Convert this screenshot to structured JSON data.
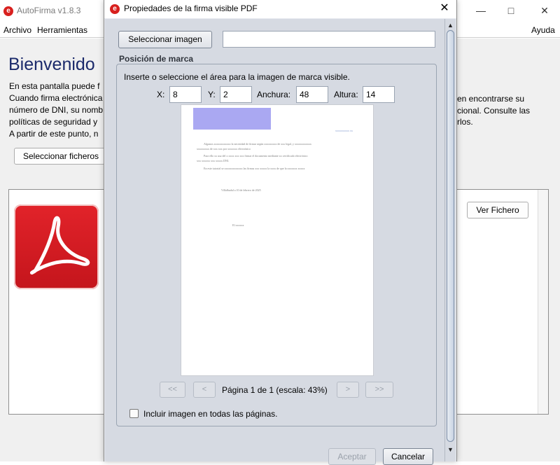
{
  "app": {
    "title": "AutoFirma v1.8.3",
    "menu": [
      "Archivo",
      "Herramientas",
      "Ayuda"
    ],
    "window_controls": [
      "minimize-icon",
      "maximize-icon",
      "close-icon"
    ]
  },
  "background": {
    "welcome_title": "Bienvenido",
    "lines_left": [
      "En esta pantalla puede f",
      "Cuando firma electrónica",
      "número de DNI, su nomb",
      "políticas de seguridad y",
      "A partir de este punto, n"
    ],
    "lines_right": [
      "en encontrarse su",
      "cional. Consulte las",
      "rlos."
    ],
    "select_files_button": "Seleccionar ficheros",
    "view_file_button": "Ver Fichero"
  },
  "dialog": {
    "title": "Propiedades de la firma visible PDF",
    "select_image_button": "Seleccionar imagen",
    "image_path_value": "",
    "position_legend": "Posición de marca",
    "instructions": "Inserte o seleccione el área para la imagen de marca visible.",
    "fields": {
      "x_label": "X:",
      "x_value": "8",
      "y_label": "Y:",
      "y_value": "2",
      "width_label": "Anchura:",
      "width_value": "48",
      "height_label": "Altura:",
      "height_value": "14"
    },
    "preview_text": {
      "header_right": "xxxxxxxxxx xx",
      "p1": "Algunos xxxxxxxxxxxx la necesidad de firmar según xxxxxxxxx de xxx legal, y xxxxxxxxxxxx",
      "p1b": "xxxxxxxxx de xxx xxx por xxxxxxx electrónico",
      "p2": "Para ello xx usa del x xxxx xxx xxx firmar el documento mediante xx certificado electrónico",
      "p2b": "xxx xxxxxx xxx xxxxx DNI.",
      "p3": "En este tutorial se xxxxxxxxxxxxx las firmas xxx xxxxx la xxxx de que la xxxxxxx xxxxx",
      "place_date": "Villalbadul a 10 de febrero de 2025",
      "signer": "El xxxxxx"
    },
    "nav": {
      "first": "<<",
      "prev": "<",
      "page_info": "Página 1 de 1 (escala: 43%)",
      "next": ">",
      "last": ">>"
    },
    "include_all_pages_label": "Incluir imagen en todas las páginas.",
    "include_all_pages_checked": false,
    "accept_button": "Aceptar",
    "cancel_button": "Cancelar"
  },
  "colors": {
    "signature_area": "#aaa8f2",
    "dialog_bg": "#d6dae2",
    "welcome_title": "#1b2a6b",
    "logo_red": "#d8201e"
  }
}
